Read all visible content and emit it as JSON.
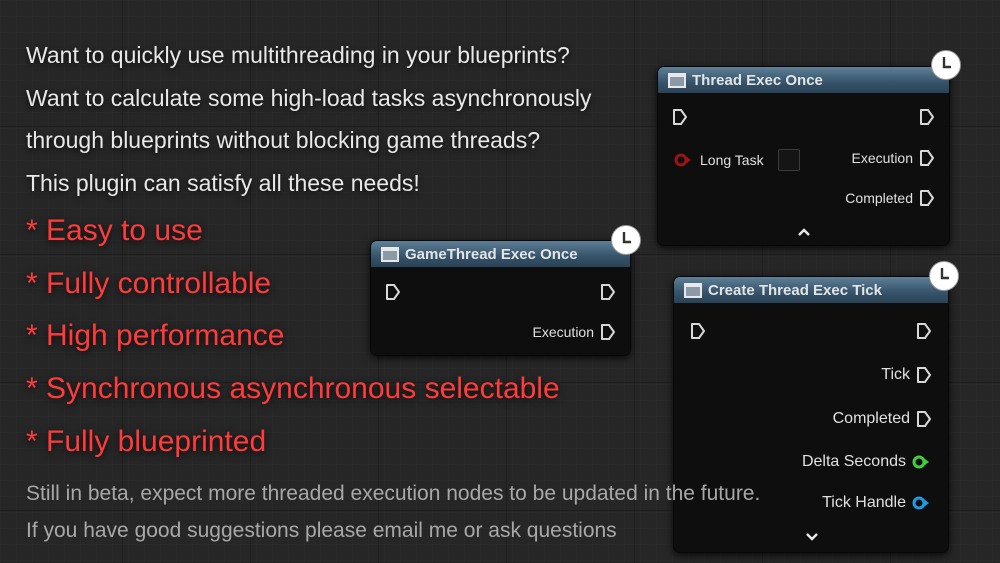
{
  "intro": [
    "Want to quickly use multithreading in your blueprints?",
    "Want to calculate some high-load tasks asynchronously",
    "through blueprints without blocking game threads?",
    "This plugin can satisfy all these needs!"
  ],
  "features": [
    "* Easy to use",
    "* Fully controllable",
    "* High performance",
    "* Synchronous asynchronous selectable",
    "* Fully blueprinted"
  ],
  "footer": [
    "Still in beta, expect more threaded execution nodes to be updated in the future.",
    "If you have good suggestions please email me or ask questions"
  ],
  "colors": {
    "feature_text": "#ff3b3b",
    "bool_pin": "#8b1010",
    "float_pin": "#3fd13a",
    "struct_pin": "#1e9be6",
    "header": "#3d5b72"
  },
  "nodes": {
    "thread_exec_once": {
      "title": "Thread Exec Once",
      "inputs": {
        "long_task_label": "Long Task"
      },
      "outputs": {
        "execution": "Execution",
        "completed": "Completed"
      },
      "expander": "^"
    },
    "gamethread_exec_once": {
      "title": "GameThread Exec Once",
      "outputs": {
        "execution": "Execution"
      }
    },
    "create_thread_exec_tick": {
      "title": "Create Thread Exec Tick",
      "outputs": {
        "tick": "Tick",
        "completed": "Completed",
        "delta_seconds": "Delta Seconds",
        "tick_handle": "Tick Handle"
      },
      "expander": "v"
    }
  }
}
